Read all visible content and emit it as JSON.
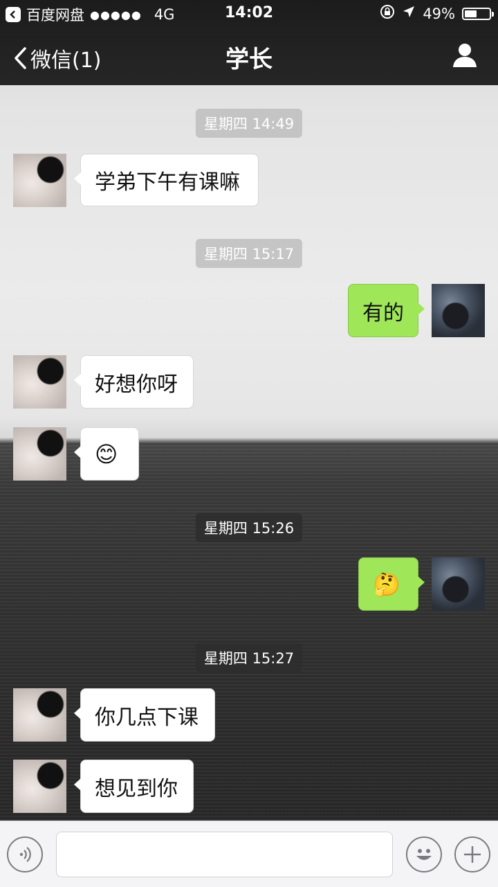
{
  "status_bar": {
    "back_app": "百度网盘",
    "signal": "●●●●●",
    "network": "4G",
    "time": "14:02",
    "battery": "49%",
    "battery_level": 0.49
  },
  "nav": {
    "back_label": "微信(1)",
    "title": "学长",
    "profile_icon": "person-icon"
  },
  "messages": {
    "ts1": "星期四 14:49",
    "m1": "学弟下午有课嘛",
    "ts2": "星期四 15:17",
    "m2": "有的",
    "m3": "好想你呀",
    "m4": "😊",
    "ts3": "星期四 15:26",
    "m5": "🤔",
    "ts4": "星期四 15:27",
    "m6": "你几点下课",
    "m7": "想见到你"
  },
  "colors": {
    "sent_bubble": "#9fe658",
    "received_bubble": "#ffffff",
    "header": "#1c1c1c"
  },
  "input_bar": {
    "voice_icon": "voice-icon",
    "emoji_icon": "emoji-icon",
    "plus_icon": "plus-icon",
    "text": ""
  }
}
